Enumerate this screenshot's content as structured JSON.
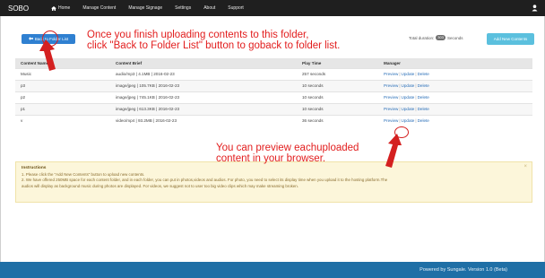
{
  "navbar": {
    "brand": "SOBO",
    "items": [
      {
        "label": "Home",
        "icon": "home-icon"
      },
      {
        "label": "Manage Content"
      },
      {
        "label": "Manage Signage"
      },
      {
        "label": "Settings"
      },
      {
        "label": "About"
      },
      {
        "label": "Support"
      }
    ],
    "user_icon": "user-icon"
  },
  "toolbar": {
    "back_label": "Back to Folder List",
    "back_icon": "arrow-left-icon",
    "total_label": "Total duration:",
    "total_value": "303",
    "total_unit": "Seconds",
    "add_label": "Add New Contents"
  },
  "table": {
    "headers": [
      "Content Name",
      "Content Brief",
      "Play Time",
      "Manager"
    ],
    "rows": [
      {
        "name": "Music",
        "brief": "audio/mp3 | 4.1MB | 2016-02-23",
        "time": "257 seconds"
      },
      {
        "name": "p3",
        "brief": "image/jpeg | 105.7KB | 2016-02-23",
        "time": "10 seconds"
      },
      {
        "name": "p2",
        "brief": "image/jpeg | 745.1KB | 2016-02-23",
        "time": "10 seconds"
      },
      {
        "name": "p1",
        "brief": "image/jpeg | 613.3KB | 2016-02-23",
        "time": "10 seconds"
      },
      {
        "name": "v",
        "brief": "video/mp4 | 93.2MB | 2016-02-23",
        "time": "36 seconds"
      }
    ],
    "actions": {
      "preview": "Preview",
      "update": "Update",
      "delete": "Delete",
      "sep": "|"
    }
  },
  "instructions": {
    "title": "Instructions",
    "line1": "1. Please click the \"Add New Contents\" button to upload new contents.",
    "line2": "2. We have offered 250MB space for each content folder, and in each folder, you can put in photos,videos and audios. For photo, you need to select its display time when you upload it to the hosting platform.The",
    "line3": "audios will display as background music during photos are displayed. For videos, we suggest not to user too big video clips which may make streaming broken.",
    "close": "×"
  },
  "footer": {
    "text": "Powered by Sungale. Version 1.0 (Beta)"
  },
  "annotations": {
    "note1_line1": "Once you finish uploading contents to this folder,",
    "note1_line2": "click \"Back to Folder List\" button to goback to folder list.",
    "note2_line1": "You can preview eachuploaded",
    "note2_line2": "content in your browser.",
    "color": "#e21d1d"
  },
  "colors": {
    "navbar": "#1f1f1f",
    "primary_button": "#2f80d1",
    "info_button": "#5bc0de",
    "footer": "#1f6fa6",
    "instructions_bg": "#fcf6da",
    "link": "#2a6fb8"
  }
}
